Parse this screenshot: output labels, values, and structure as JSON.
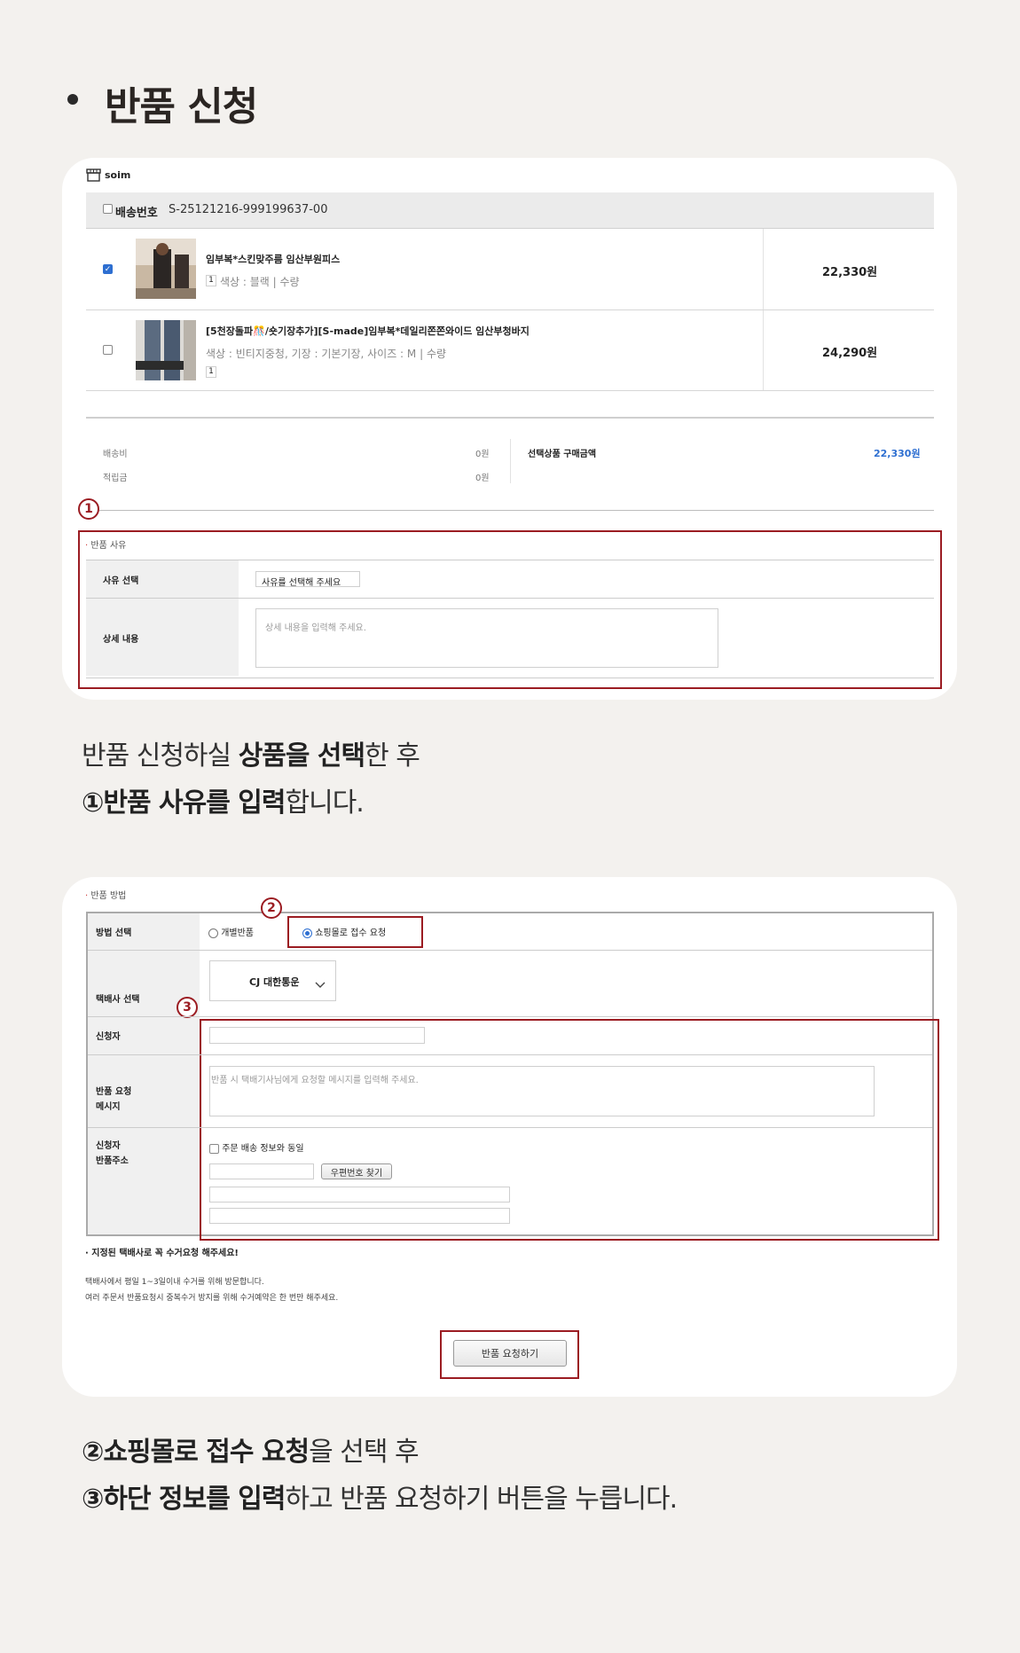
{
  "page": {
    "title": "반품 신청"
  },
  "step1": {
    "shop_name": "soim",
    "delivery_label": "배송번호",
    "delivery_number": "S-25121216-999199637-00",
    "products": [
      {
        "name": "임부복*스킨맞주름 임산부원피스",
        "options": "색상 : 블랙 | 수량",
        "qty": "1",
        "price": "22,330원",
        "checked": true
      },
      {
        "name": "[5천장돌파🎊/숏기장추가][S-made]임부복*데일리쫀쫀와이드 임산부청바지",
        "options": "색상 : 빈티지중청, 기장 : 기본기장, 사이즈 : M | 수량",
        "qty": "1",
        "price": "24,290원",
        "checked": false
      }
    ],
    "shipping_label": "배송비",
    "shipping_value": "0원",
    "points_label": "적립금",
    "points_value": "0원",
    "selected_total_label": "선택상품 구매금액",
    "selected_total_value": "22,330원",
    "marker": "1",
    "reason_section": "반품 사유",
    "reason_select_label": "사유 선택",
    "reason_select_value": "사유를 선택해 주세요",
    "detail_label": "상세 내용",
    "detail_placeholder": "상세 내용을 입력해 주세요.",
    "accent_color": "#9b1c22"
  },
  "desc1": {
    "line1_a": "반품 신청하실 ",
    "line1_b": "상품을 선택",
    "line1_c": "한 후",
    "line2_a": "①반품 사유를 입력",
    "line2_b": "합니다."
  },
  "step2": {
    "section": "반품 방법",
    "method_label": "방법 선택",
    "method_option1": "개별반품",
    "method_option2": "쇼핑몰로 접수 요청",
    "marker2": "2",
    "courier_label": "택배사 선택",
    "courier_value": "CJ 대한통운",
    "marker3": "3",
    "applicant_label": "신청자",
    "message_label_1": "반품 요청",
    "message_label_2": "메시지",
    "message_placeholder": "반품 시 택배기사님에게 요청할 메시지를 입력해 주세요.",
    "address_label_1": "신청자",
    "address_label_2": "반품주소",
    "same_as_order": "주문 배송 정보와 동일",
    "zipcode_button": "우편번호 찾기",
    "notice_title": "· 지정된 택배사로 꼭 수거요청 해주세요!",
    "notice_line1": "택배사에서 평일 1~3일이내 수거를 위해 방문합니다.",
    "notice_line2": "여러 주문서 반품요청시 중복수거 방지를 위해 수거예약은 한 번만 해주세요.",
    "submit_button": "반품 요청하기"
  },
  "desc2": {
    "line1_a": "②쇼핑몰로 접수 요청",
    "line1_b": "을 선택 후",
    "line2_a": "③하단 정보를 입력",
    "line2_b": "하고 반품 요청하기 버튼을 누릅니다."
  }
}
